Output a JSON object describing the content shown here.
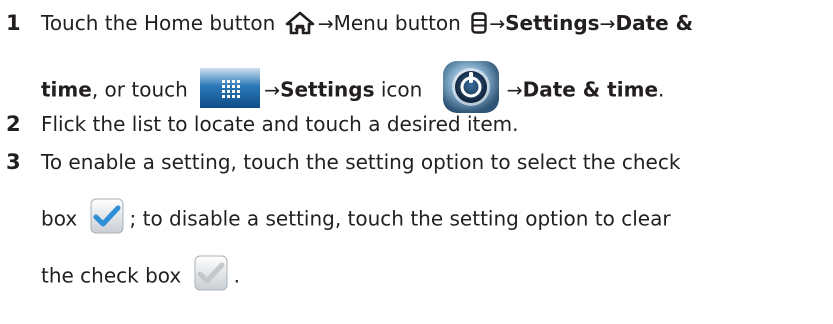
{
  "steps": [
    {
      "number": "1",
      "line1": {
        "t1": "Touch the Home button",
        "arrow1": "→",
        "t2": "Menu button",
        "arrow2": "→",
        "b1": "Settings",
        "arrow3": "→",
        "b2": "Date &"
      },
      "line2": {
        "b1": "time",
        "t1": ", or touch",
        "arrow1": "→",
        "b2": "Settings",
        "t2": " icon",
        "arrow2": "→",
        "b3": "Date & time",
        "t3": "."
      }
    },
    {
      "number": "2",
      "text": "Flick the list to locate and touch a desired item."
    },
    {
      "number": "3",
      "line1": "To enable a setting, touch the setting option to select the check",
      "line2": {
        "t1": "box",
        "t2": "; to disable a setting, touch the setting option to clear"
      },
      "line3": {
        "t1": "the check box",
        "t2": "."
      }
    }
  ],
  "icons": {
    "home": "home-icon",
    "menu": "menu-icon",
    "apps": "apps-grid-icon",
    "settings": "settings-icon",
    "checked": "checkbox-checked-icon",
    "unchecked": "checkbox-unchecked-icon"
  },
  "colors": {
    "text": "#231f20",
    "check_blue": "#2e8fd6",
    "apps_blue": "#1f74b8"
  }
}
